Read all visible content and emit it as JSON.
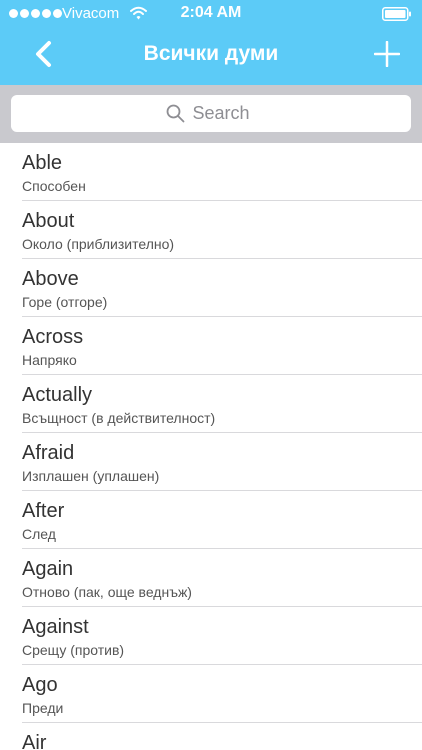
{
  "status_bar": {
    "carrier": "Vivacom",
    "time": "2:04 AM",
    "signal_icon": "signal-dots-icon",
    "wifi_icon": "wifi-icon",
    "battery_icon": "battery-icon"
  },
  "nav": {
    "title": "Всички думи",
    "back_icon": "chevron-left-icon",
    "add_icon": "plus-icon"
  },
  "search": {
    "placeholder": "Search",
    "value": ""
  },
  "words": [
    {
      "word": "Able",
      "translation": "Способен"
    },
    {
      "word": "About",
      "translation": "Около (приблизително)"
    },
    {
      "word": "Above",
      "translation": "Горе (отгоре)"
    },
    {
      "word": "Across",
      "translation": "Напряко"
    },
    {
      "word": "Actually",
      "translation": "Всъщност (в действителност)"
    },
    {
      "word": "Afraid",
      "translation": "Изплашен (уплашен)"
    },
    {
      "word": "After",
      "translation": "След"
    },
    {
      "word": "Again",
      "translation": "Отново (пак, още веднъж)"
    },
    {
      "word": "Against",
      "translation": "Срещу (против)"
    },
    {
      "word": "Ago",
      "translation": "Преди"
    },
    {
      "word": "Air",
      "translation": ""
    }
  ],
  "colors": {
    "header": "#5ccbf7",
    "search_background": "#c9c9ce",
    "separator": "#d9d9dc"
  }
}
